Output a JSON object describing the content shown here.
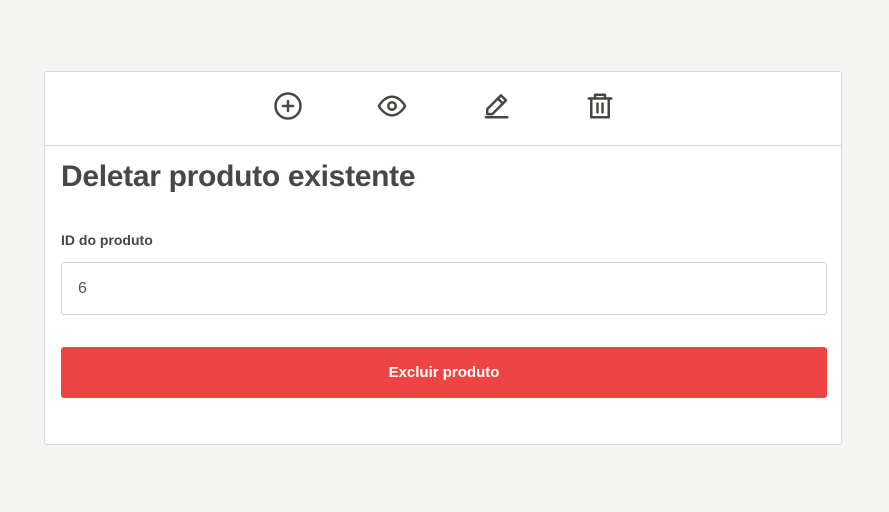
{
  "toolbar": {
    "icons": [
      "plus-circle-icon",
      "eye-icon",
      "pencil-icon",
      "trash-icon"
    ],
    "icon_color": "#4a4742"
  },
  "form": {
    "title": "Deletar produto existente",
    "id_label": "ID do produto",
    "id_value": "6",
    "submit_label": "Excluir produto",
    "submit_color": "#ef4444"
  }
}
